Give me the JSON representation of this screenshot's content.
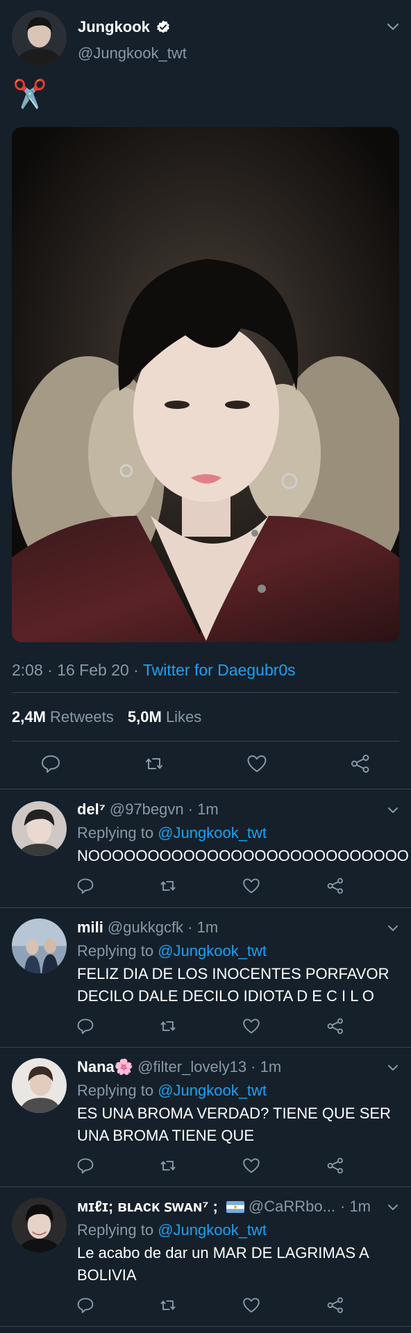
{
  "main_tweet": {
    "name": "Jungkook",
    "handle": "@Jungkook_twt",
    "text": "✂️",
    "time": "2:08 · 16 Feb 20 · ",
    "source": "Twitter for Daegubr0s",
    "retweets_count": "2,4M",
    "retweets_label": "Retweets",
    "likes_count": "5,0M",
    "likes_label": "Likes"
  },
  "replies": [
    {
      "name": "del⁷",
      "meta": "@97begvn · 1m",
      "replying_prefix": "Replying to ",
      "mention": "@Jungkook_twt",
      "body": "NOOOOOOOOOOOOOOOOOOOOOOOOOOO"
    },
    {
      "name": "mili",
      "meta": "@gukkgcfk · 1m",
      "replying_prefix": "Replying to ",
      "mention": "@Jungkook_twt",
      "body": "FELIZ DIA DE LOS INOCENTES PORFAVOR DECILO DALE DECILO IDIOTA D E C I L O"
    },
    {
      "name": "Nana🌸",
      "meta": "@filter_lovely13 · 1m",
      "replying_prefix": "Replying to ",
      "mention": "@Jungkook_twt",
      "body": "ES UNA BROMA VERDAD? TIENE QUE SER UNA BROMA TIENE QUE"
    },
    {
      "name": "ᴍɪℓɪ; ʙʟᴀᴄᴋ ꜱᴡᴀɴ⁷ ;",
      "meta": "@CaRRbo...",
      "time": "· 1m",
      "replying_prefix": "Replying to ",
      "mention": "@Jungkook_twt",
      "body": "Le acabo de dar un MAR DE LAGRIMAS A BOLIVIA"
    }
  ],
  "icons": [
    "verified-icon",
    "chevron-down-icon",
    "reply-icon",
    "retweet-icon",
    "like-icon",
    "share-icon",
    "argentina-flag-icon"
  ],
  "colors": {
    "background": "#15202b",
    "accent": "#1da1f2",
    "secondary_text": "#8899a6",
    "divider": "#38444d"
  }
}
